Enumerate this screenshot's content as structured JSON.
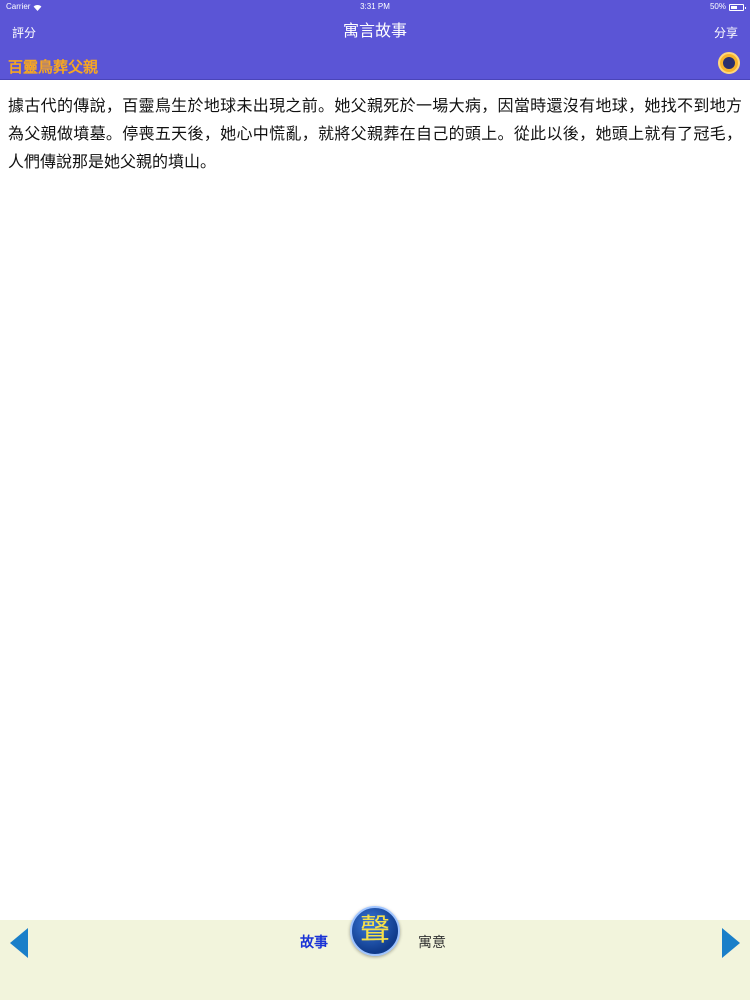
{
  "status": {
    "carrier": "Carrier",
    "time": "3:31 PM",
    "battery": "50%",
    "battery_level": 0.5
  },
  "nav": {
    "title": "寓言故事",
    "left": "評分",
    "right": "分享"
  },
  "story": {
    "title": "百靈鳥葬父親",
    "body": "據古代的傳說，百靈鳥生於地球未出現之前。她父親死於一場大病，因當時還沒有地球，她找不到地方為父親做墳墓。停喪五天後，她心中慌亂，就將父親葬在自己的頭上。從此以後，她頭上就有了冠毛，人們傳說那是她父親的墳山。"
  },
  "footer": {
    "tab_story": "故事",
    "tab_moral": "寓意",
    "sound_label": "聲"
  },
  "colors": {
    "header": "#5b55d6",
    "title_accent": "#f5a623",
    "footer": "#f2f4dc",
    "arrow": "#1a7fc9"
  }
}
